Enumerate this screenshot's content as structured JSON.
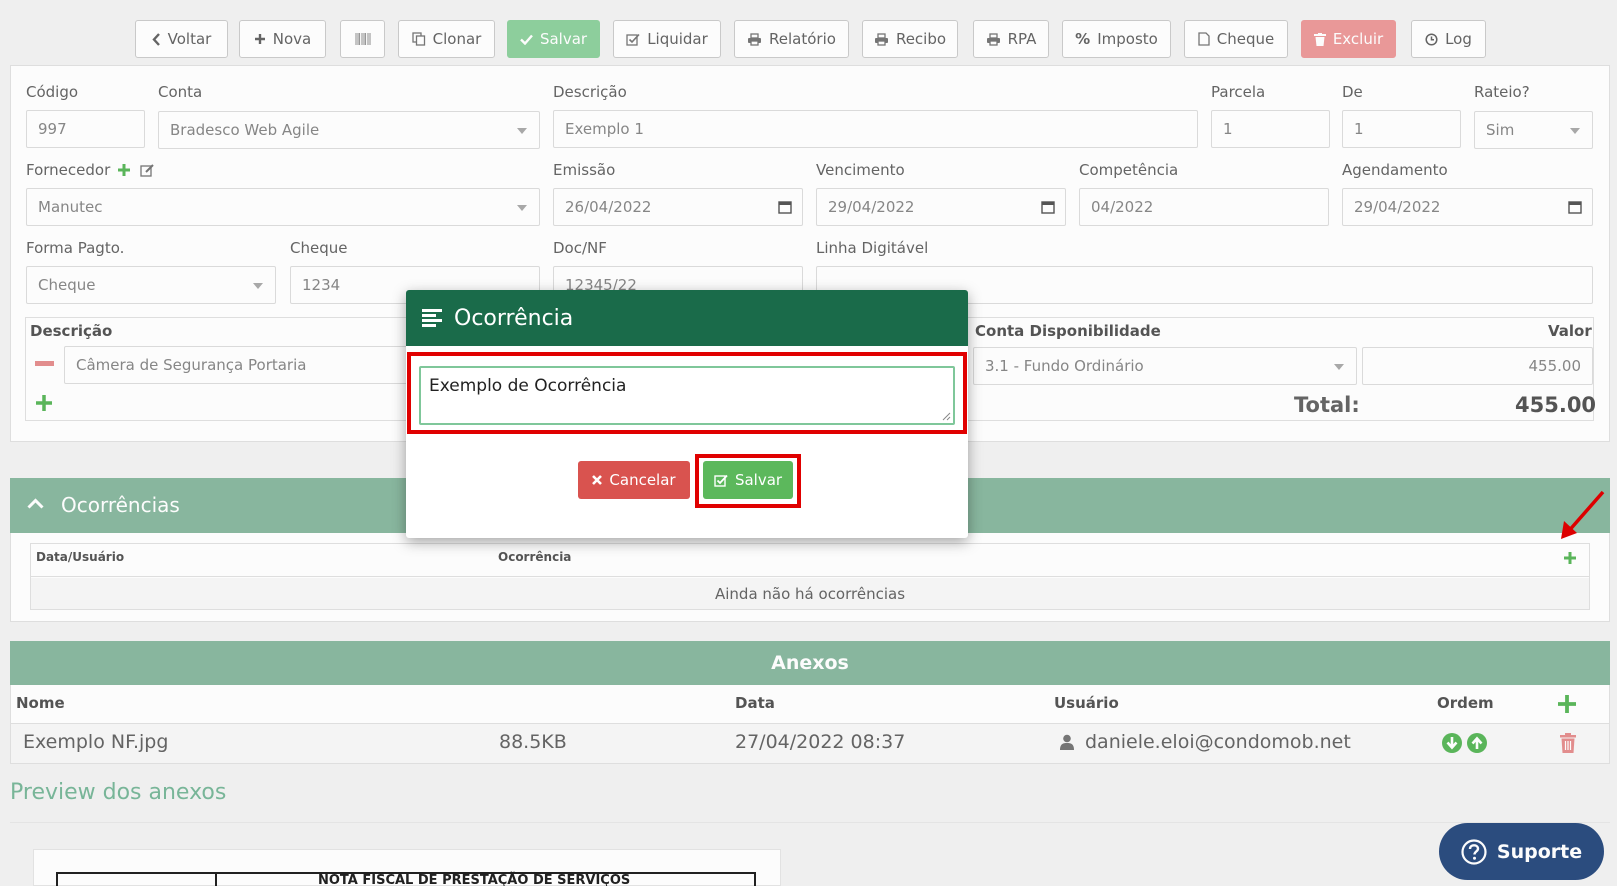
{
  "toolbar": {
    "voltar": "Voltar",
    "nova": "Nova",
    "clonar": "Clonar",
    "salvar": "Salvar",
    "liquidar": "Liquidar",
    "relatorio": "Relatório",
    "recibo": "Recibo",
    "rpa": "RPA",
    "imposto": "Imposto",
    "cheque": "Cheque",
    "excluir": "Excluir",
    "log": "Log"
  },
  "form": {
    "codigo_label": "Código",
    "codigo_value": "997",
    "conta_label": "Conta",
    "conta_value": "Bradesco Web Agile",
    "descricao_label": "Descrição",
    "descricao_value": "Exemplo 1",
    "parcela_label": "Parcela",
    "parcela_value": "1",
    "de_label": "De",
    "de_value": "1",
    "rateio_label": "Rateio?",
    "rateio_value": "Sim",
    "fornecedor_label": "Fornecedor",
    "fornecedor_value": "Manutec",
    "emissao_label": "Emissão",
    "emissao_value": "26/04/2022",
    "vencimento_label": "Vencimento",
    "vencimento_value": "29/04/2022",
    "competencia_label": "Competência",
    "competencia_value": "04/2022",
    "agendamento_label": "Agendamento",
    "agendamento_value": "29/04/2022",
    "forma_pagto_label": "Forma Pagto.",
    "forma_pagto_value": "Cheque",
    "cheque_label": "Cheque",
    "cheque_value": "1234",
    "doc_nf_label": "Doc/NF",
    "doc_nf_value": "12345/22",
    "linha_digitavel_label": "Linha Digitável",
    "linha_digitavel_value": ""
  },
  "rateio": {
    "col_descricao": "Descrição",
    "col_conta": "Conta Disponibilidade",
    "col_valor": "Valor",
    "item_descricao": "Câmera de Segurança Portaria",
    "item_conta": "3.1 - Fundo Ordinário",
    "item_valor": "455.00",
    "total_label": "Total:",
    "total_value": "455.00"
  },
  "ocorrencias": {
    "title": "Ocorrências",
    "col_data_usuario": "Data/Usuário",
    "col_ocorrencia": "Ocorrência",
    "empty": "Ainda não há ocorrências"
  },
  "anexos": {
    "title": "Anexos",
    "col_nome": "Nome",
    "col_data": "Data",
    "col_usuario": "Usuário",
    "col_ordem": "Ordem",
    "rows": [
      {
        "nome": "Exemplo NF.jpg",
        "tamanho": "88.5KB",
        "data": "27/04/2022 08:37",
        "usuario": "daniele.eloi@condomob.net"
      }
    ],
    "preview_title": "Preview dos anexos",
    "doc_heading": "NOTA FISCAL DE PRESTAÇÃO DE SERVIÇOS"
  },
  "modal": {
    "title": "Ocorrência",
    "textarea_value": "Exemplo de Ocorrência",
    "cancelar": "Cancelar",
    "salvar": "Salvar"
  },
  "suporte": "Suporte",
  "colors": {
    "primary_green": "#1a6b4a",
    "section_green": "#8ab9a0",
    "button_green": "#5cb85c",
    "button_red": "#d9534f",
    "highlight_red": "#e00000"
  }
}
